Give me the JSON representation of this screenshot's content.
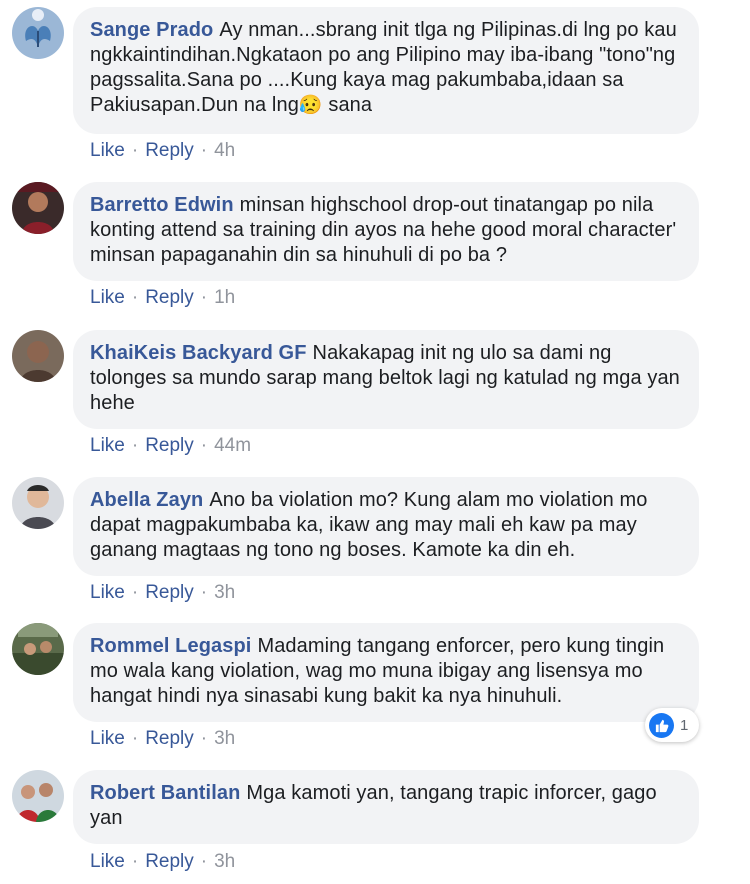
{
  "ui": {
    "like_label": "Like",
    "reply_label": "Reply",
    "separator": "·"
  },
  "comments": [
    {
      "author": "Sange Prado",
      "text": "Ay nman...sbrang init tlga ng Pilipinas.di lng po kau ngkkaintindihan.Ngkataon po ang Pilipino may iba-ibang \"tono\"ng pagssalita.Sana po ....Kung kaya mag pakumbaba,idaan sa Pakiusapan.Dun na lng",
      "emoji": "😥",
      "text_tail": "sana",
      "time": "4h"
    },
    {
      "author": "Barretto Edwin",
      "text": "minsan highschool drop-out tinatangap po nila konting attend sa training din ayos na hehe good moral character' minsan papaganahin din sa hinuhuli di po ba ?",
      "time": "1h"
    },
    {
      "author": "KhaiKeis Backyard GF",
      "text": "Nakakapag init ng ulo sa dami ng tolonges sa mundo sarap mang beltok lagi ng katulad ng mga yan hehe",
      "time": "44m"
    },
    {
      "author": "Abella Zayn",
      "text": "Ano ba violation mo? Kung alam mo violation mo dapat magpakumbaba ka, ikaw ang may mali eh kaw pa may ganang magtaas ng tono ng boses. Kamote ka din eh.",
      "time": "3h"
    },
    {
      "author": "Rommel Legaspi",
      "text": "Madaming tangang enforcer, pero kung tingin mo wala kang violation, wag mo muna ibigay ang lisensya mo hangat hindi nya sinasabi kung bakit ka nya hinuhuli.",
      "time": "3h",
      "reaction_count": "1"
    },
    {
      "author": "Robert Bantilan",
      "text": "Mga kamoti yan, tangang trapic inforcer, gago yan",
      "time": "3h"
    }
  ],
  "colors": {
    "name": "#385898",
    "bubble": "#f2f3f5",
    "meta": "#90949c",
    "like_blue": "#1877f2"
  }
}
